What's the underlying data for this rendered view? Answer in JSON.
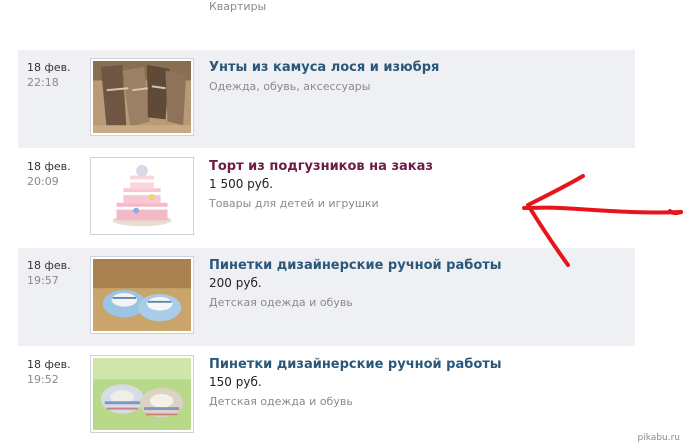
{
  "previous": {
    "category": "Квартиры"
  },
  "listings": [
    {
      "date": "18 фев.",
      "time": "22:18",
      "title": "Унты из камуса лося и изюбря",
      "price": "",
      "category": "Одежда, обувь, аксессуары",
      "image_icon": "fur-boots-photo"
    },
    {
      "date": "18 фев.",
      "time": "20:09",
      "title": "Торт из подгузников на заказ",
      "price": "1 500 руб.",
      "category": "Товары для детей и игрушки",
      "image_icon": "diaper-cake-photo"
    },
    {
      "date": "18 фев.",
      "time": "19:57",
      "title": "Пинетки дизайнерские ручной работы",
      "price": "200 руб.",
      "category": "Детская одежда и обувь",
      "image_icon": "blue-booties-photo"
    },
    {
      "date": "18 фев.",
      "time": "19:52",
      "title": "Пинетки дизайнерские ручной работы",
      "price": "150 руб.",
      "category": "Детская одежда и обувь",
      "image_icon": "multicolor-booties-photo"
    }
  ],
  "annotation": {
    "icon": "hand-drawn-red-arrow",
    "color": "#e8141c"
  },
  "watermark": "pikabu.ru",
  "colors": {
    "link": "#2b587a",
    "visited_link": "#6b1d44",
    "muted": "#8a8a8a",
    "row_shade": "#eef0f3"
  }
}
